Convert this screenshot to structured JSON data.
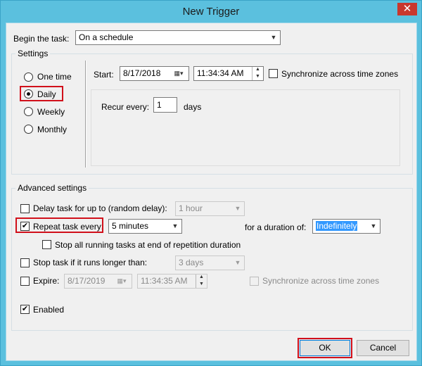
{
  "window": {
    "title": "New Trigger",
    "close_glyph": "✕"
  },
  "begin": {
    "label": "Begin the task:",
    "value": "On a schedule"
  },
  "settings": {
    "title": "Settings",
    "options": [
      {
        "label": "One time",
        "checked": false
      },
      {
        "label": "Daily",
        "checked": true
      },
      {
        "label": "Weekly",
        "checked": false
      },
      {
        "label": "Monthly",
        "checked": false
      }
    ],
    "start_label": "Start:",
    "start_date": "8/17/2018",
    "start_time": "11:34:34 AM",
    "sync_label": "Synchronize across time zones",
    "recur_label": "Recur every:",
    "recur_value": "1",
    "recur_unit": "days"
  },
  "advanced": {
    "title": "Advanced settings",
    "delay_label": "Delay task for up to (random delay):",
    "delay_value": "1 hour",
    "repeat_label": "Repeat task every:",
    "repeat_value": "5 minutes",
    "duration_label": "for a duration of:",
    "duration_value": "Indefinitely",
    "stop_all_label": "Stop all running tasks at end of repetition duration",
    "stop_if_label": "Stop task if it runs longer than:",
    "stop_if_value": "3 days",
    "expire_label": "Expire:",
    "expire_date": "8/17/2019",
    "expire_time": "11:34:35 AM",
    "expire_sync_label": "Synchronize across time zones",
    "enabled_label": "Enabled"
  },
  "buttons": {
    "ok": "OK",
    "cancel": "Cancel"
  },
  "colors": {
    "titlebar": "#5bc0de",
    "highlight": "#d1101b",
    "selection": "#3399ff",
    "close": "#c8372d"
  }
}
